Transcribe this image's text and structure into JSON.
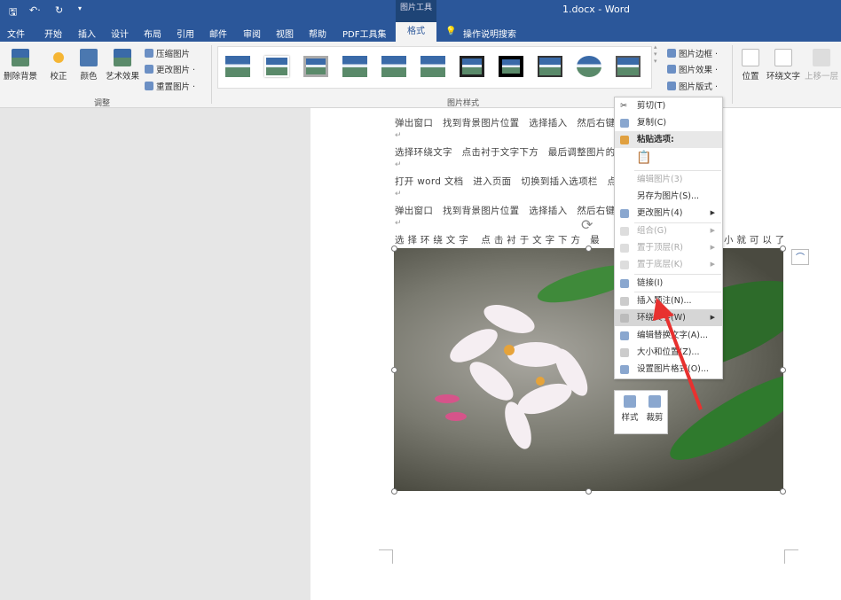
{
  "titlebar": {
    "context_tool": "图片工具",
    "title": "1.docx  -  Word"
  },
  "tabs": [
    "文件",
    "开始",
    "插入",
    "设计",
    "布局",
    "引用",
    "邮件",
    "审阅",
    "视图",
    "帮助",
    "PDF工具集",
    "格式"
  ],
  "search": "操作说明搜索",
  "ribbon": {
    "adjust": {
      "remove_bg": "删除背景",
      "correct": "校正",
      "color": "颜色",
      "artistic": "艺术效果",
      "compress": "压缩图片",
      "change": "更改图片 ·",
      "reset": "重置图片 ·",
      "group": "调整"
    },
    "styles": {
      "border": "图片边框 ·",
      "effects": "图片效果 ·",
      "layout": "图片版式 ·",
      "group": "图片样式"
    },
    "arrange": {
      "position": "位置",
      "wrap": "环绕文字",
      "forward": "上移一层"
    }
  },
  "document": {
    "lines": [
      "弹出窗口　找到背景图片位置　选择插入　然后右键",
      "选择环绕文字　点击衬于文字下方　最后调整图片的",
      "打开 word 文档　进入页面　切换到插入选项栏　点",
      "弹出窗口　找到背景图片位置　选择插入　然后右键",
      "选 择 环 绕 文 字　 点 击 衬 于 文 字 下 方　最"
    ],
    "tail": "小 就 可 以 了"
  },
  "context_menu": {
    "items": [
      {
        "label": "剪切(T)",
        "disabled": false
      },
      {
        "label": "复制(C)",
        "disabled": false
      },
      {
        "label": "粘贴选项:",
        "disabled": false
      },
      {
        "label": "编辑图片(3)",
        "disabled": true
      },
      {
        "label": "另存为图片(S)...",
        "disabled": false
      },
      {
        "label": "更改图片(4)",
        "disabled": false
      },
      {
        "label": "组合(G)",
        "disabled": true
      },
      {
        "label": "置于顶层(R)",
        "disabled": true
      },
      {
        "label": "置于底层(K)",
        "disabled": true
      },
      {
        "label": "链接(I)",
        "disabled": false
      },
      {
        "label": "插入题注(N)...",
        "disabled": false
      },
      {
        "label": "环绕文字(W)",
        "disabled": false
      },
      {
        "label": "编辑替换文字(A)...",
        "disabled": false
      },
      {
        "label": "大小和位置(Z)...",
        "disabled": false
      },
      {
        "label": "设置图片格式(O)...",
        "disabled": false
      }
    ]
  },
  "mini_toolbar": {
    "style": "样式",
    "crop": "裁剪"
  },
  "colors": {
    "accent": "#2b579a",
    "arrow": "#e8312f"
  }
}
